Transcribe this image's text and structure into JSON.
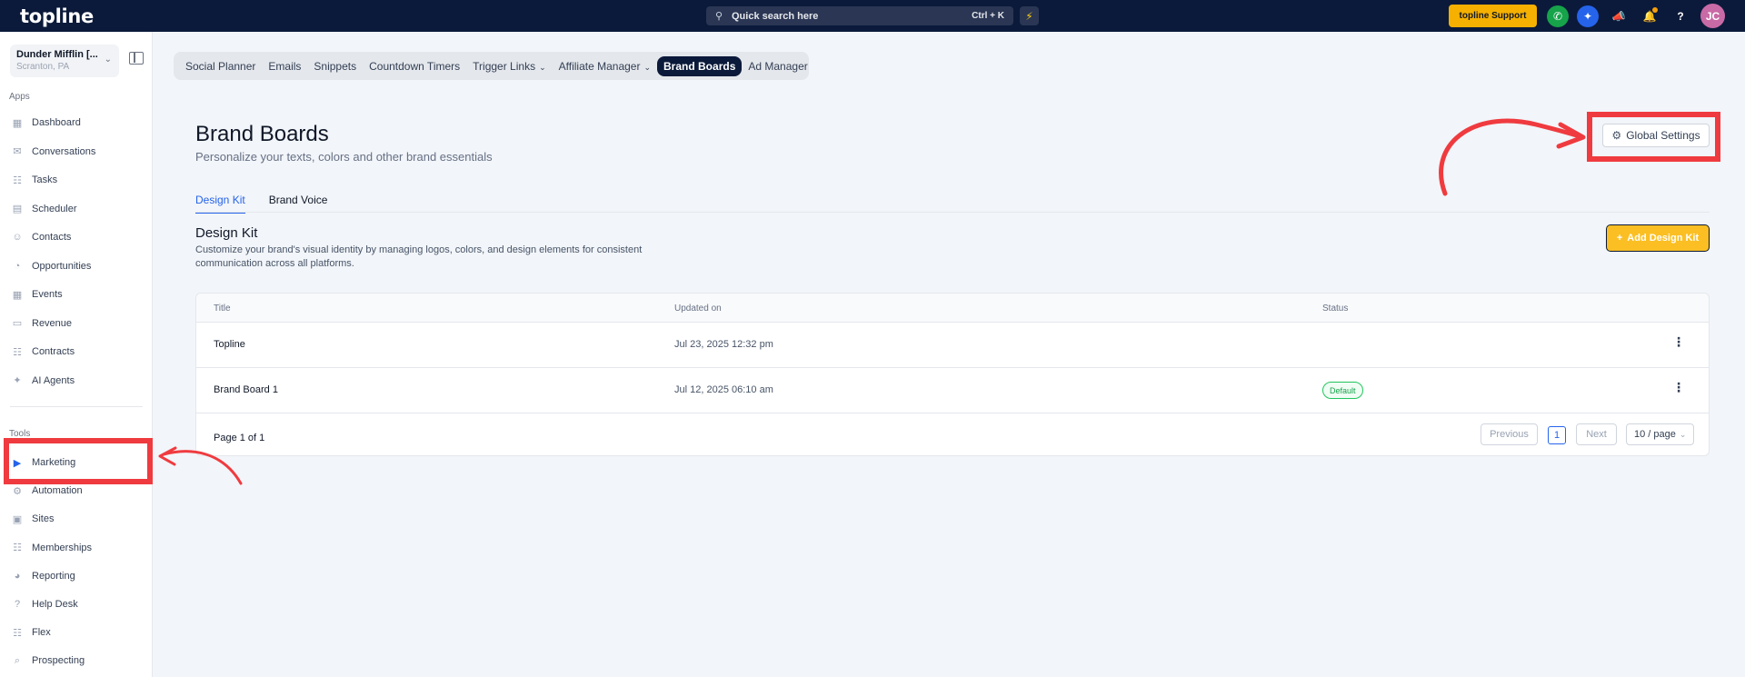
{
  "topbar": {
    "logo": "topline",
    "search_label": "Quick search here",
    "search_shortcut": "Ctrl + K",
    "support_label": "topline Support",
    "avatar_initials": "JC"
  },
  "sidebar": {
    "location_name": "Dunder Mifflin [...",
    "location_sub": "Scranton, PA",
    "apps_label": "Apps",
    "tools_label": "Tools",
    "apps": [
      {
        "label": "Dashboard",
        "icon": "dashboard-icon"
      },
      {
        "label": "Conversations",
        "icon": "chat-icon"
      },
      {
        "label": "Tasks",
        "icon": "clipboard-icon"
      },
      {
        "label": "Scheduler",
        "icon": "calendar-icon"
      },
      {
        "label": "Contacts",
        "icon": "person-icon"
      },
      {
        "label": "Opportunities",
        "icon": "pie-icon"
      },
      {
        "label": "Events",
        "icon": "grid-icon"
      },
      {
        "label": "Revenue",
        "icon": "card-icon"
      },
      {
        "label": "Contracts",
        "icon": "document-icon"
      },
      {
        "label": "AI Agents",
        "icon": "sparkle-icon"
      }
    ],
    "tools": [
      {
        "label": "Marketing",
        "icon": "megaphone-icon"
      },
      {
        "label": "Automation",
        "icon": "gears-icon"
      },
      {
        "label": "Sites",
        "icon": "monitor-icon"
      },
      {
        "label": "Memberships",
        "icon": "users-icon"
      },
      {
        "label": "Reporting",
        "icon": "chart-icon"
      },
      {
        "label": "Help Desk",
        "icon": "help-icon"
      },
      {
        "label": "Flex",
        "icon": "people-icon"
      },
      {
        "label": "Prospecting",
        "icon": "search-icon"
      }
    ]
  },
  "tabs": [
    {
      "label": "Social Planner",
      "dropdown": false,
      "active": false
    },
    {
      "label": "Emails",
      "dropdown": false,
      "active": false
    },
    {
      "label": "Snippets",
      "dropdown": false,
      "active": false
    },
    {
      "label": "Countdown Timers",
      "dropdown": false,
      "active": false
    },
    {
      "label": "Trigger Links",
      "dropdown": true,
      "active": false
    },
    {
      "label": "Affiliate Manager",
      "dropdown": true,
      "active": false
    },
    {
      "label": "Brand Boards",
      "dropdown": false,
      "active": true
    },
    {
      "label": "Ad Manager",
      "dropdown": false,
      "active": false
    }
  ],
  "page": {
    "title": "Brand Boards",
    "subtitle": "Personalize your texts, colors and other brand essentials",
    "global_settings": "Global Settings",
    "subtabs": [
      "Design Kit",
      "Brand Voice"
    ],
    "section_title": "Design Kit",
    "section_desc": "Customize your brand's visual identity by managing logos, colors, and design elements for consistent communication across all platforms.",
    "add_button": "Add Design Kit"
  },
  "table": {
    "headers": [
      "Title",
      "Updated on",
      "Status"
    ],
    "rows": [
      {
        "title": "Topline",
        "updated": "Jul 23, 2025 12:32 pm",
        "status": ""
      },
      {
        "title": "Brand Board 1",
        "updated": "Jul 12, 2025 06:10 am",
        "status": "Default"
      }
    ],
    "page_info": "Page 1 of 1",
    "prev": "Previous",
    "next": "Next",
    "current_page": "1",
    "page_size": "10 / page"
  },
  "colors": {
    "topbar": "#0b1a3a",
    "accent": "#2563eb",
    "brand_yellow": "#fbbf24",
    "highlight_red": "#ef3b3f"
  }
}
